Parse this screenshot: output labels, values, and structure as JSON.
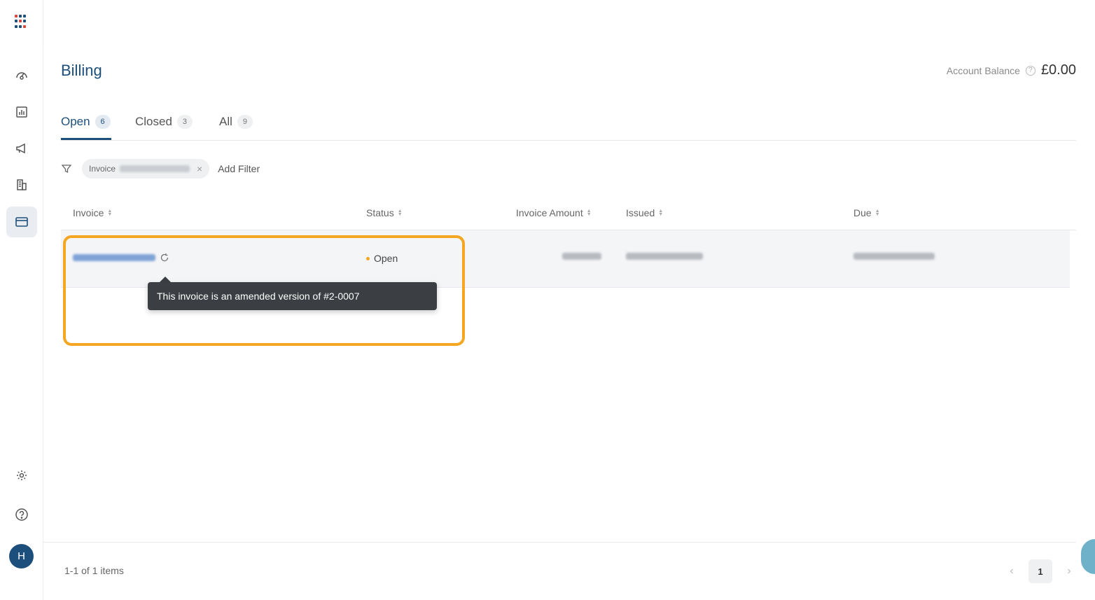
{
  "sidebar": {
    "items": [
      {
        "icon": "dashboard-icon"
      },
      {
        "icon": "reports-icon"
      },
      {
        "icon": "campaigns-icon"
      },
      {
        "icon": "buildings-icon"
      },
      {
        "icon": "billing-card-icon",
        "active": true
      }
    ],
    "bottom": [
      {
        "icon": "settings-gear-icon"
      },
      {
        "icon": "help-icon"
      }
    ],
    "avatar_initial": "H"
  },
  "page": {
    "title": "Billing",
    "balance_label": "Account Balance",
    "balance_info": "?",
    "balance_value": "£0.00"
  },
  "tabs": [
    {
      "label": "Open",
      "count": "6",
      "active": true
    },
    {
      "label": "Closed",
      "count": "3"
    },
    {
      "label": "All",
      "count": "9"
    }
  ],
  "filter": {
    "chip_label": "Invoice",
    "chip_close": "×",
    "add_filter": "Add Filter"
  },
  "table": {
    "headers": {
      "invoice": "Invoice",
      "status": "Status",
      "amount": "Invoice Amount",
      "issued": "Issued",
      "due": "Due"
    },
    "sort_up": "▲",
    "sort_down": "▼",
    "rows": [
      {
        "status": "Open"
      }
    ]
  },
  "tooltip": "This invoice is an amended version of #2-0007",
  "footer": {
    "items_count": "1-1 of 1 items",
    "prev": "‹",
    "page": "1",
    "next": "›"
  },
  "colors": {
    "brand": "#1d4f7c",
    "highlight": "#f5a623",
    "status_open": "#f5a623"
  }
}
